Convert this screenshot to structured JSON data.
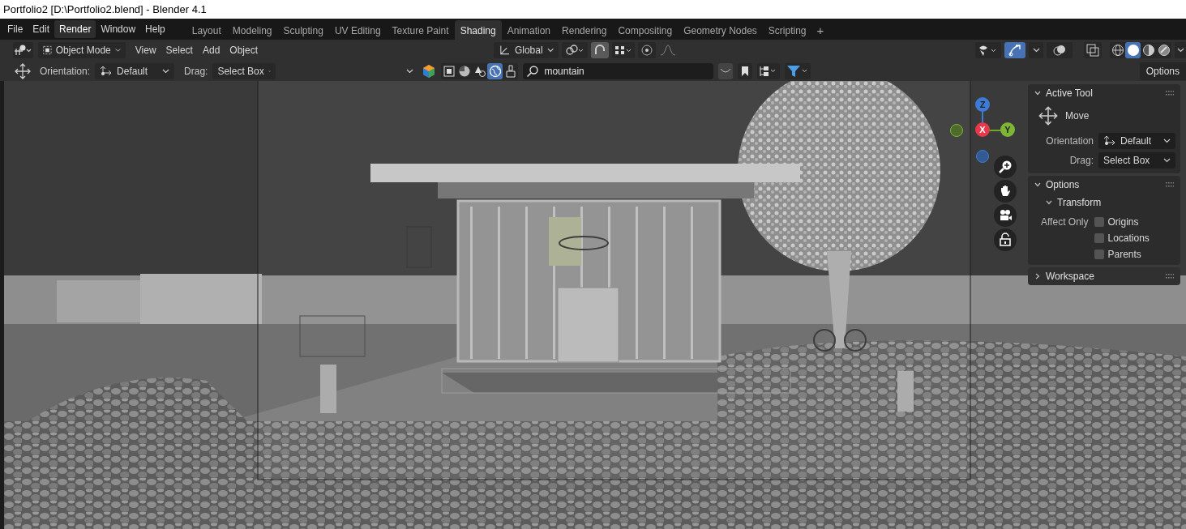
{
  "window": {
    "title": "Portfolio2 [D:\\Portfolio2.blend] - Blender 4.1"
  },
  "menu": [
    {
      "label": "File",
      "highlighted": false
    },
    {
      "label": "Edit",
      "highlighted": false
    },
    {
      "label": "Render",
      "highlighted": true
    },
    {
      "label": "Window",
      "highlighted": false
    },
    {
      "label": "Help",
      "highlighted": false
    }
  ],
  "workspace_tabs": [
    {
      "label": "Layout",
      "selected": false
    },
    {
      "label": "Modeling",
      "selected": false
    },
    {
      "label": "Sculpting",
      "selected": false
    },
    {
      "label": "UV Editing",
      "selected": false
    },
    {
      "label": "Texture Paint",
      "selected": false
    },
    {
      "label": "Shading",
      "selected": true
    },
    {
      "label": "Animation",
      "selected": false
    },
    {
      "label": "Rendering",
      "selected": false
    },
    {
      "label": "Compositing",
      "selected": false
    },
    {
      "label": "Geometry Nodes",
      "selected": false
    },
    {
      "label": "Scripting",
      "selected": false
    }
  ],
  "add_tab": "+",
  "header": {
    "mode": "Object Mode",
    "menus": [
      "View",
      "Select",
      "Add",
      "Object"
    ],
    "transform_orientation": "Global",
    "snap_on": true,
    "proportional_on": false,
    "gizmos_on": true,
    "shading_modes": [
      {
        "kind": "wireframe",
        "selected": false
      },
      {
        "kind": "solid",
        "selected": true
      },
      {
        "kind": "material",
        "selected": false
      },
      {
        "kind": "rendered",
        "selected": false
      }
    ]
  },
  "tool_settings": {
    "orientation_label": "Orientation:",
    "orientation": "Default",
    "drag_label": "Drag:",
    "drag": "Select Box"
  },
  "outliner_filter": {
    "search": "mountain",
    "filters": [
      {
        "kind": "select",
        "selected": false
      },
      {
        "kind": "pie",
        "selected": false
      },
      {
        "kind": "light",
        "selected": false
      },
      {
        "kind": "world",
        "selected": true
      },
      {
        "kind": "brush",
        "selected": false
      }
    ]
  },
  "options_button": "Options",
  "gizmo": {
    "z": "Z",
    "x": "X",
    "y": "Y"
  },
  "sidebar": {
    "active_tool": {
      "title": "Active Tool",
      "expanded": true,
      "tool": "Move",
      "orientation_label": "Orientation",
      "orientation": "Default",
      "drag_label": "Drag:",
      "drag": "Select Box"
    },
    "options": {
      "title": "Options",
      "expanded": true,
      "subpanel": {
        "title": "Transform",
        "expanded": true
      },
      "affect_only_label": "Affect Only",
      "checkboxes": [
        {
          "label": "Origins",
          "checked": false
        },
        {
          "label": "Locations",
          "checked": false
        },
        {
          "label": "Parents",
          "checked": false
        }
      ]
    },
    "workspace": {
      "title": "Workspace",
      "expanded": false
    }
  }
}
